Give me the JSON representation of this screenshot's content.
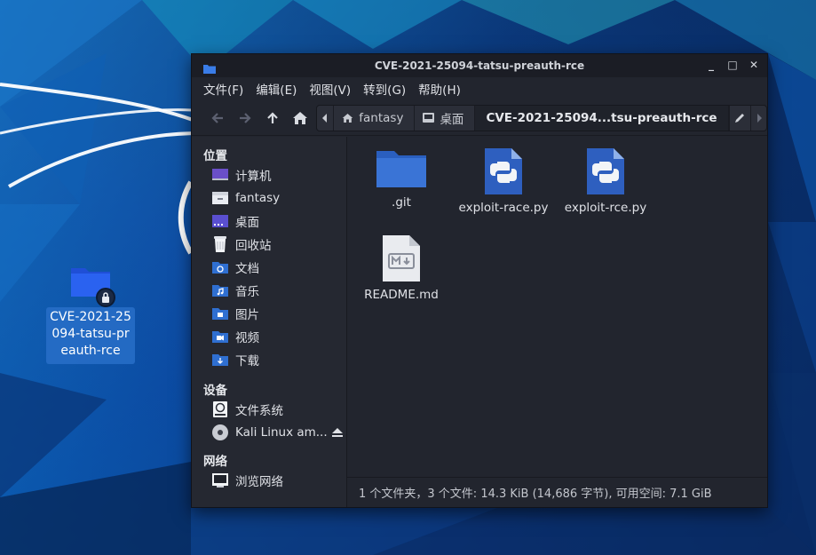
{
  "desktop": {
    "icon_label": "CVE-2021-25094-tatsu-preauth-rce"
  },
  "window": {
    "title": "CVE-2021-25094-tatsu-preauth-rce",
    "controls": {
      "minimize": "_",
      "maximize": "□",
      "close": "✕"
    }
  },
  "menubar": {
    "items": [
      "文件(F)",
      "编辑(E)",
      "视图(V)",
      "转到(G)",
      "帮助(H)"
    ]
  },
  "pathbar": {
    "segments": [
      "fantasy",
      "桌面",
      "CVE-2021-25094...tsu-preauth-rce"
    ]
  },
  "sidebar": {
    "places_header": "位置",
    "places": [
      {
        "label": "计算机",
        "icon": "computer-icon"
      },
      {
        "label": "fantasy",
        "icon": "home-folder-icon"
      },
      {
        "label": "桌面",
        "icon": "desktop-icon"
      },
      {
        "label": "回收站",
        "icon": "trash-icon"
      },
      {
        "label": "文档",
        "icon": "documents-folder-icon"
      },
      {
        "label": "音乐",
        "icon": "music-folder-icon"
      },
      {
        "label": "图片",
        "icon": "pictures-folder-icon"
      },
      {
        "label": "视频",
        "icon": "videos-folder-icon"
      },
      {
        "label": "下载",
        "icon": "downloads-folder-icon"
      }
    ],
    "devices_header": "设备",
    "devices": [
      {
        "label": "文件系统",
        "icon": "drive-icon"
      },
      {
        "label": "Kali Linux am...",
        "icon": "cdrom-icon"
      }
    ],
    "network_header": "网络",
    "network": [
      {
        "label": "浏览网络",
        "icon": "network-icon"
      }
    ]
  },
  "files": [
    {
      "name": ".git",
      "icon": "folder-icon"
    },
    {
      "name": "exploit-race.py",
      "icon": "python-file-icon"
    },
    {
      "name": "exploit-rce.py",
      "icon": "python-file-icon"
    },
    {
      "name": "README.md",
      "icon": "markdown-file-icon"
    }
  ],
  "status": {
    "text": "1 个文件夹，3 个文件: 14.3 KiB (14,686 字节), 可用空间: 7.1 GiB"
  },
  "colors": {
    "window_bg": "#22252e",
    "accent_blue": "#2f6fd1",
    "python_blue": "#2e5fbf"
  }
}
